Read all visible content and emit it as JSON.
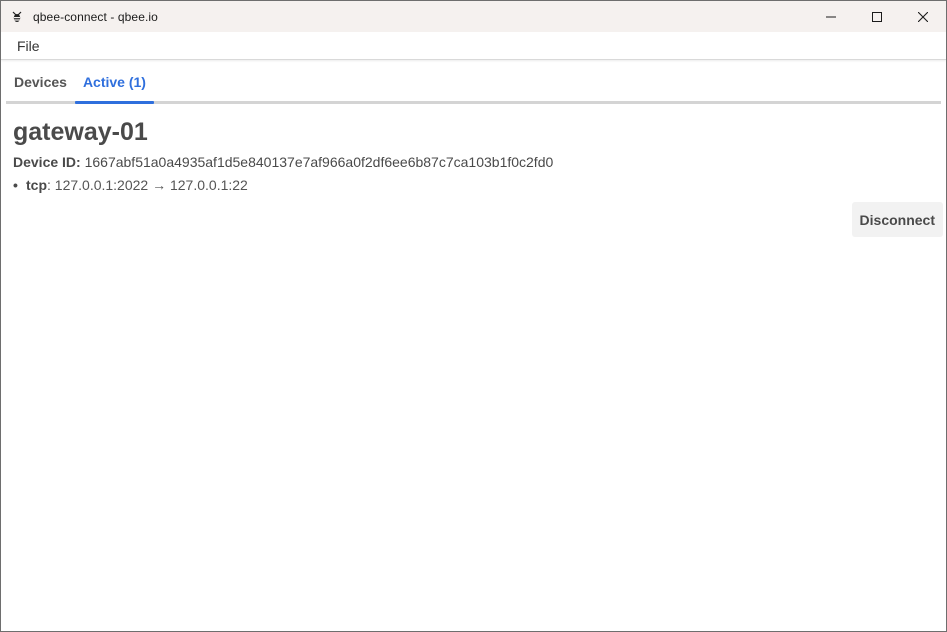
{
  "window": {
    "title": "qbee-connect - qbee.io",
    "app_icon": "qbee-bee-icon",
    "controls": [
      "minimize-icon",
      "maximize-icon",
      "close-icon"
    ]
  },
  "menu": {
    "items": [
      {
        "label": "File"
      }
    ]
  },
  "tabs": [
    {
      "label": "Devices",
      "active": false
    },
    {
      "label": "Active (1)",
      "active": true
    }
  ],
  "device": {
    "name": "gateway-01",
    "id_label": "Device ID:",
    "id_value": "1667abf51a0a4935af1d5e840137e7af966a0f2df6ee6b87c7ca103b1f0c2fd0",
    "connections": [
      {
        "protocol": "tcp",
        "mapping": ": 127.0.0.1:2022 → 127.0.0.1:22"
      }
    ]
  },
  "actions": {
    "disconnect_label": "Disconnect"
  },
  "colors": {
    "accent": "#2f6fdd",
    "titlebar_bg": "#f5f1ef",
    "text": "#4a4a4a"
  }
}
